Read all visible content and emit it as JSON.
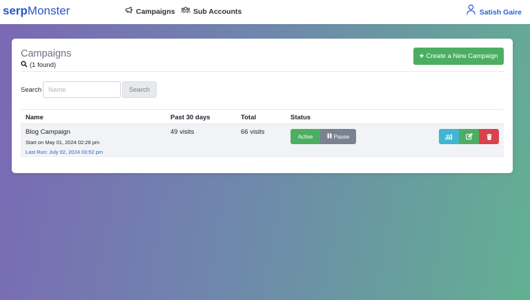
{
  "navbar": {
    "brand_bold": "serp",
    "brand_light": "Monster",
    "campaigns_label": "Campaigns",
    "sub_accounts_label": "Sub Accounts",
    "user_name": "Satish Gaire"
  },
  "campaigns": {
    "title": "Campaigns",
    "found_text": "(1 found)",
    "create_button_label": "Create a New Campaign",
    "search_label": "Search",
    "search_placeholder": "Name",
    "search_button_label": "Search"
  },
  "table": {
    "columns": [
      "Name",
      "Past 30 days",
      "Total",
      "Status"
    ],
    "rows": [
      {
        "name": "Blog Campaign",
        "start": "Start on May 01, 2024 02:28 pm",
        "last_run": "Last Run: July 02, 2024 03:52 pm",
        "past_30_days": "49 visits",
        "total": "66 visits",
        "status_active_label": "Active",
        "status_pause_label": "Pause"
      }
    ]
  },
  "colors": {
    "brand": "#2a54c7",
    "success": "#4cae62",
    "info": "#42b4d4",
    "danger": "#d9414b",
    "secondary": "#7a8191",
    "link": "#2a62d6"
  },
  "icons": {
    "nav_campaigns": "megaphone-icon",
    "nav_sub_accounts": "users-icon",
    "nav_user": "user-icon",
    "found": "search-icon",
    "pause": "pause-icon",
    "actions": [
      "bar-chart-icon",
      "edit-icon",
      "trash-icon"
    ]
  }
}
